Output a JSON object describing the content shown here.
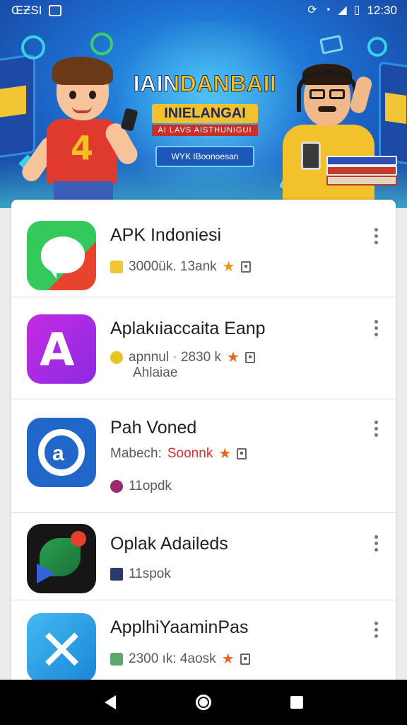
{
  "status_bar": {
    "left_text": "ŒƵSI",
    "time": "12:30",
    "icons": [
      "notification-icon",
      "sync-icon",
      "wifi-icon",
      "signal-icon",
      "battery-icon"
    ]
  },
  "hero": {
    "title": "IAINDANBAII",
    "subtitle": "INIELANGAI",
    "tag": "AI LAVS AISTHUNIGUI",
    "button_label": "WYK IBoonoesan"
  },
  "apps": [
    {
      "name": "APK Indoniesi",
      "meta": "3000ük.  13ank",
      "extra": "",
      "line3": "",
      "icon": "chat-bubble-icon"
    },
    {
      "name": "Aplakıiaccaita Eanp",
      "meta": "apnnul · 2830 k",
      "extra": "Ahlaiae",
      "line3": "",
      "icon": "app-store-icon"
    },
    {
      "name": "Pah Voned",
      "meta": "Mabech:",
      "meta_red": "Soonnk",
      "line3": "11opdk",
      "icon": "ring-icon"
    },
    {
      "name": "Oplak Adaileds",
      "meta": "11spok",
      "extra": "",
      "line3": "",
      "icon": "map-pin-icon"
    },
    {
      "name": "ApplhiYaaminPas",
      "meta": "2300 ık: 4аоsk",
      "extra": "",
      "line3": "",
      "icon": "tools-icon"
    }
  ],
  "colors": {
    "star": "#e89a12",
    "nav_bg": "#000000"
  }
}
